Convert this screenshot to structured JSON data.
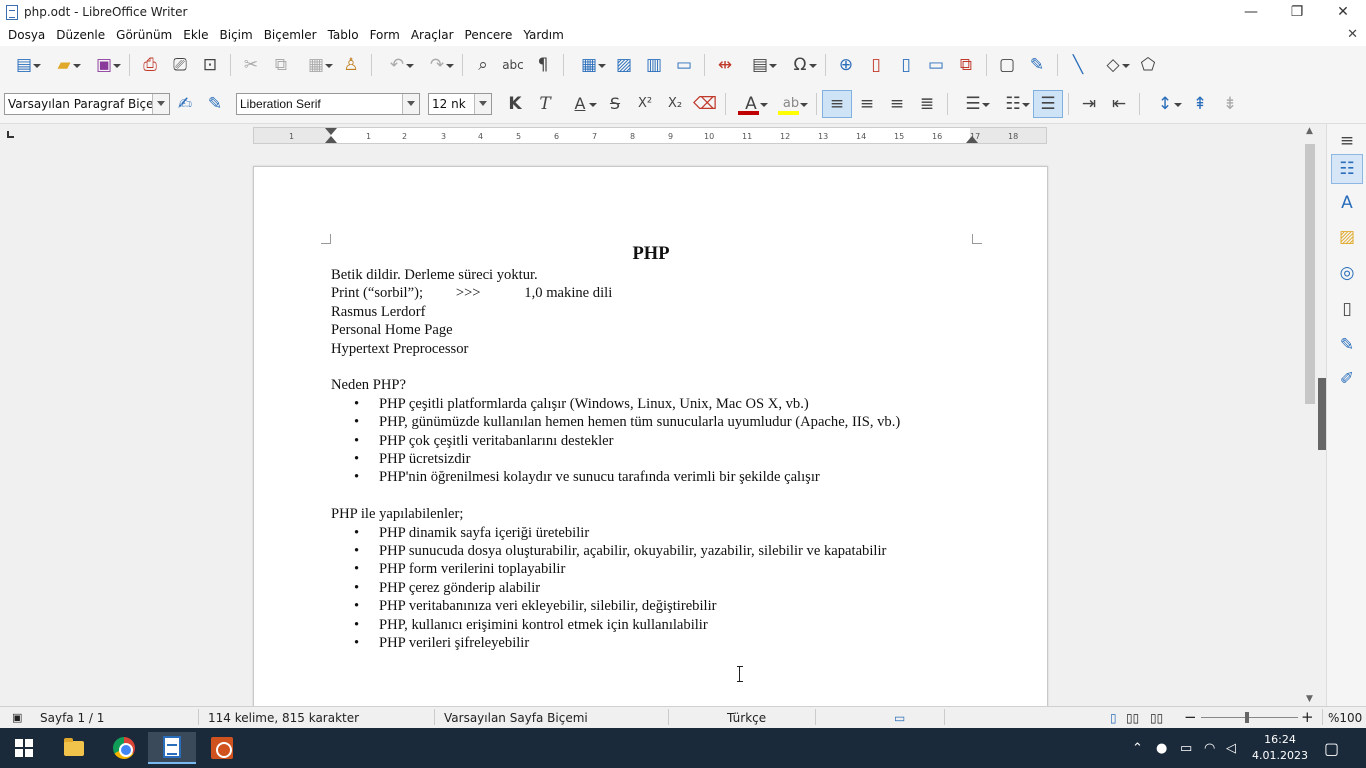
{
  "window": {
    "title": "php.odt - LibreOffice Writer",
    "controls": {
      "minimize": "—",
      "maximize": "❐",
      "close": "✕"
    }
  },
  "menu": {
    "items": [
      {
        "label": "Dosya"
      },
      {
        "label": "Düzenle"
      },
      {
        "label": "Görünüm"
      },
      {
        "label": "Ekle"
      },
      {
        "label": "Biçim"
      },
      {
        "label": "Biçemler"
      },
      {
        "label": "Tablo"
      },
      {
        "label": "Form"
      },
      {
        "label": "Araçlar"
      },
      {
        "label": "Pencere"
      },
      {
        "label": "Yardım"
      }
    ],
    "close_doc": "✕"
  },
  "formatting": {
    "paragraph_style": "Varsayılan Paragraf Biçemi",
    "font_name": "Liberation Serif",
    "font_size": "12 nk",
    "bold": "K",
    "italic": "T",
    "underline": "A",
    "strike": "S",
    "superscript": "X²",
    "subscript": "X₂",
    "font_color": "A",
    "font_color_hex": "#c00000",
    "highlight_hex": "#ffff00"
  },
  "ruler": {
    "numbers": [
      "1",
      "1",
      "2",
      "3",
      "4",
      "5",
      "6",
      "7",
      "8",
      "9",
      "10",
      "11",
      "12",
      "13",
      "14",
      "15",
      "16",
      "17",
      "18"
    ]
  },
  "document": {
    "heading": "PHP",
    "lines": [
      "Betik dildir. Derleme süreci yoktur.",
      "Print (“sorbil”);         >>>            1,0 makine dili",
      "Rasmus Lerdorf",
      "Personal Home Page",
      "Hypertext Preprocessor"
    ],
    "section1_title": "Neden PHP?",
    "section1_items": [
      "PHP çeşitli platformlarda çalışır (Windows, Linux, Unix, Mac OS X, vb.)",
      "PHP, günümüzde kullanılan hemen hemen tüm sunucularla uyumludur (Apache, IIS, vb.)",
      "PHP çok çeşitli veritabanlarını destekler",
      "PHP ücretsizdir",
      "PHP'nin öğrenilmesi kolaydır ve sunucu tarafında verimli bir şekilde çalışır"
    ],
    "section2_title": "PHP ile yapılabilenler;",
    "section2_items": [
      "PHP dinamik sayfa içeriği üretebilir",
      "PHP sunucuda dosya oluşturabilir, açabilir, okuyabilir, yazabilir, silebilir ve kapatabilir",
      "PHP form verilerini toplayabilir",
      "PHP çerez gönderip alabilir",
      "PHP veritabanınıza veri ekleyebilir, silebilir, değiştirebilir",
      "PHP, kullanıcı erişimini kontrol etmek için kullanılabilir",
      "PHP verileri şifreleyebilir"
    ]
  },
  "status": {
    "page": "Sayfa 1 / 1",
    "words": "114 kelime, 815 karakter",
    "page_style": "Varsayılan Sayfa Biçemi",
    "language": "Türkçe",
    "zoom": "%100"
  },
  "taskbar": {
    "time": "16:24",
    "date": "4.01.2023"
  }
}
